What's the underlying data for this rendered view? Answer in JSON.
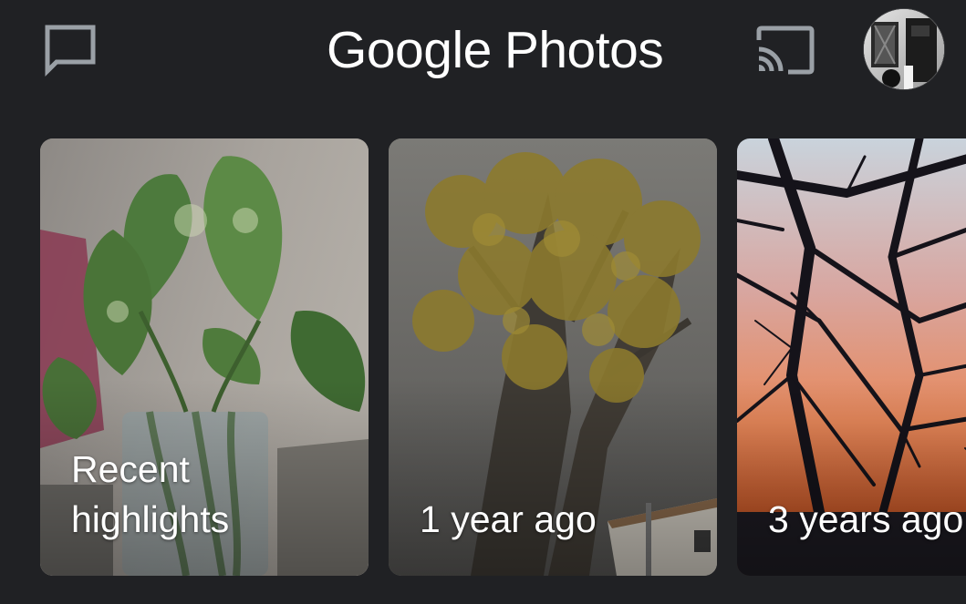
{
  "header": {
    "brand": "Google",
    "product": "Photos"
  },
  "highlights": [
    {
      "label": "Recent\nhighlights"
    },
    {
      "label": "1 year ago"
    },
    {
      "label": "3 years ago"
    }
  ],
  "icons": {
    "feedback": "feedback-icon",
    "cast": "cast-icon",
    "avatar": "account-avatar"
  },
  "colors": {
    "background": "#202124",
    "text": "#ffffff",
    "icon": "#9aa0a6"
  }
}
